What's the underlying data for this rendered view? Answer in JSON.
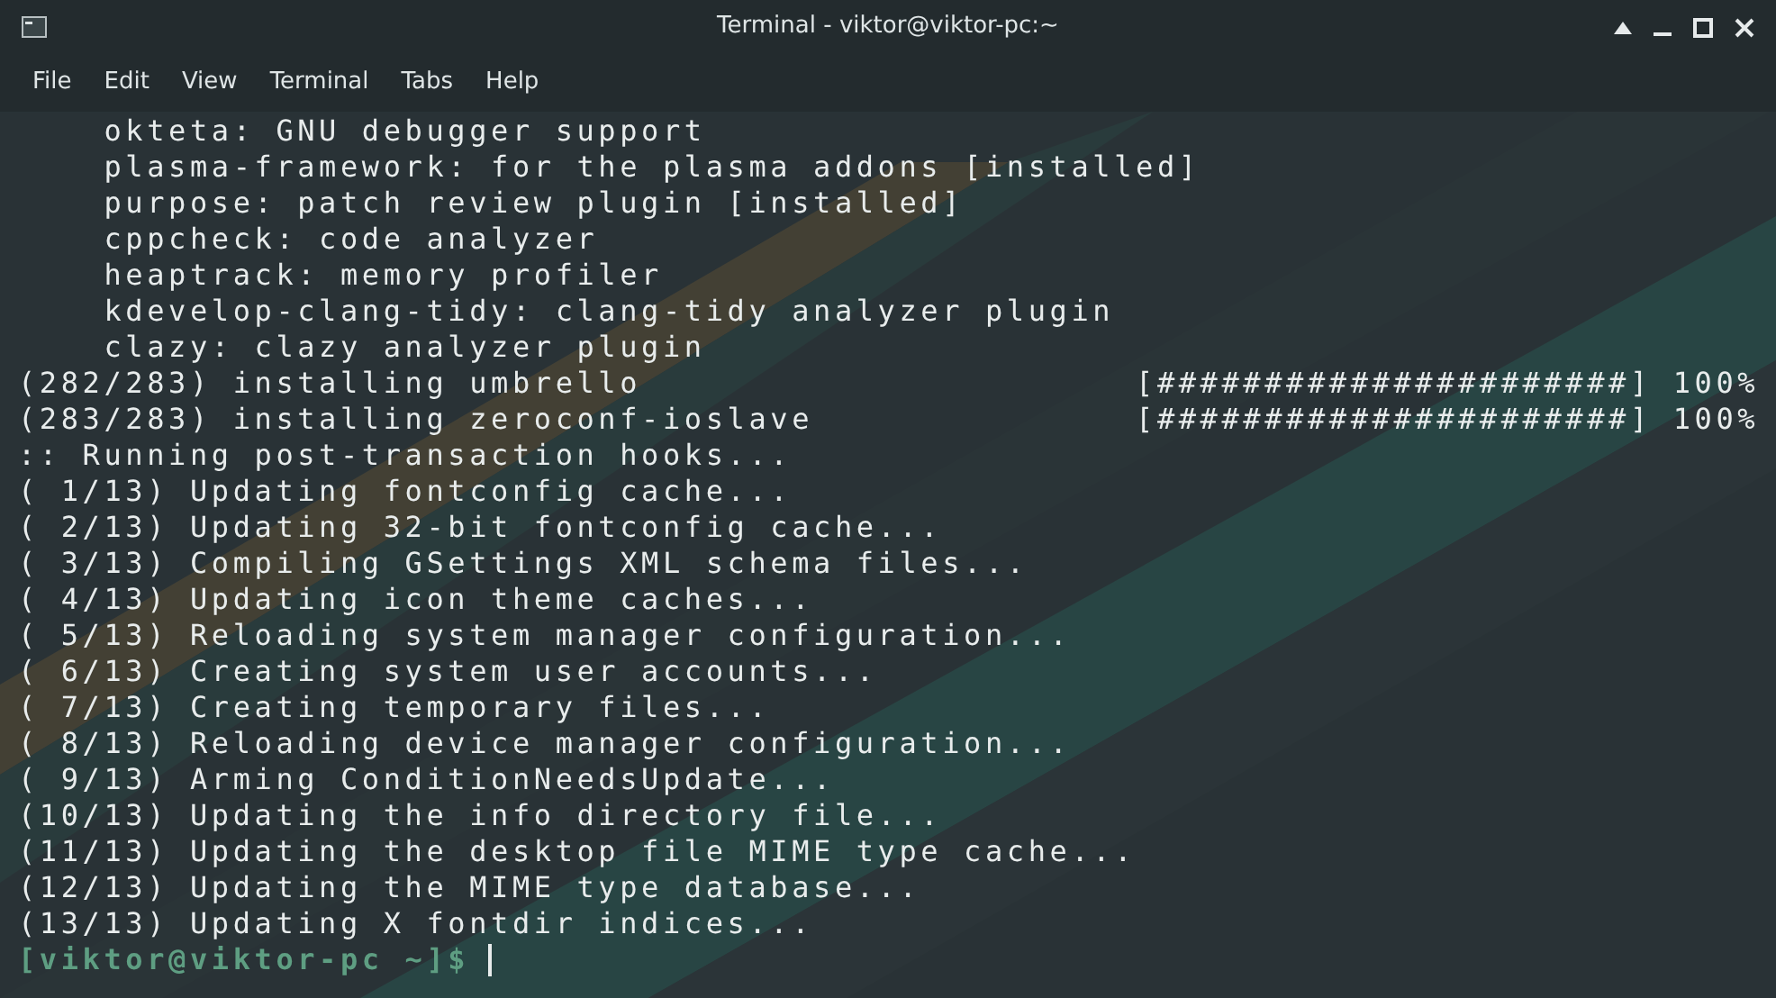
{
  "window": {
    "title": "Terminal - viktor@viktor-pc:~"
  },
  "menu": [
    "File",
    "Edit",
    "View",
    "Terminal",
    "Tabs",
    "Help"
  ],
  "lines": [
    "    okteta: GNU debugger support",
    "    plasma-framework: for the plasma addons [installed]",
    "    purpose: patch review plugin [installed]",
    "    cppcheck: code analyzer",
    "    heaptrack: memory profiler",
    "    kdevelop-clang-tidy: clang-tidy analyzer plugin",
    "    clazy: clazy analyzer plugin",
    "(282/283) installing umbrello                       [######################] 100%",
    "(283/283) installing zeroconf-ioslave               [######################] 100%",
    ":: Running post-transaction hooks...",
    "( 1/13) Updating fontconfig cache...",
    "( 2/13) Updating 32-bit fontconfig cache...",
    "( 3/13) Compiling GSettings XML schema files...",
    "( 4/13) Updating icon theme caches...",
    "( 5/13) Reloading system manager configuration...",
    "( 6/13) Creating system user accounts...",
    "( 7/13) Creating temporary files...",
    "( 8/13) Reloading device manager configuration...",
    "( 9/13) Arming ConditionNeedsUpdate...",
    "(10/13) Updating the info directory file...",
    "(11/13) Updating the desktop file MIME type cache...",
    "(12/13) Updating the MIME type database...",
    "(13/13) Updating X fontdir indices..."
  ],
  "prompt": "[viktor@viktor-pc ~]$"
}
